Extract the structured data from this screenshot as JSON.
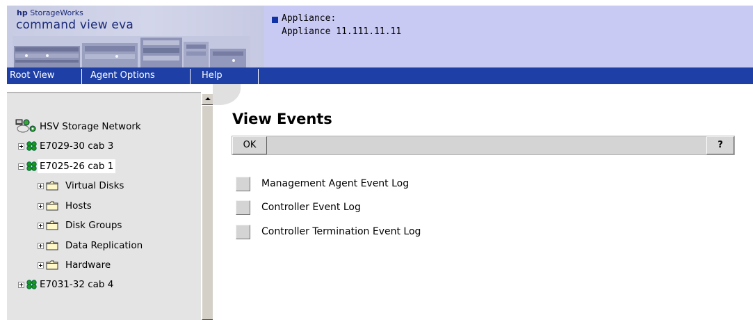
{
  "logo": {
    "vendor": "hp",
    "product_line": "StorageWorks",
    "product_name": "command view eva"
  },
  "appliance": {
    "label": "Appliance:",
    "value": "Appliance 11.111.11.11",
    "bullet_color": "#1232a8"
  },
  "menu": {
    "items": [
      {
        "label": "Root View"
      },
      {
        "label": "Agent Options"
      },
      {
        "label": "Help"
      }
    ],
    "background_color": "#1e40a6"
  },
  "tree": {
    "root": {
      "label": "HSV Storage Network",
      "icon": "storage-network-icon"
    },
    "cabinets": [
      {
        "label": "E7029-30 cab 3",
        "expanded": false,
        "icon": "cabinet-icon"
      },
      {
        "label": "E7025-26 cab 1",
        "expanded": true,
        "selected": true,
        "icon": "cabinet-icon"
      },
      {
        "label": "E7031-32 cab 4",
        "expanded": false,
        "icon": "cabinet-icon"
      }
    ],
    "folders": [
      {
        "label": "Virtual Disks",
        "icon": "folder-icon"
      },
      {
        "label": "Hosts",
        "icon": "folder-icon"
      },
      {
        "label": "Disk Groups",
        "icon": "folder-icon"
      },
      {
        "label": "Data Replication",
        "icon": "folder-icon"
      },
      {
        "label": "Hardware",
        "icon": "folder-icon"
      }
    ]
  },
  "content": {
    "title": "View Events",
    "ok_label": "OK",
    "help_label": "?",
    "events": [
      {
        "label": "Management Agent Event Log"
      },
      {
        "label": "Controller Event Log"
      },
      {
        "label": "Controller Termination Event Log"
      }
    ]
  }
}
